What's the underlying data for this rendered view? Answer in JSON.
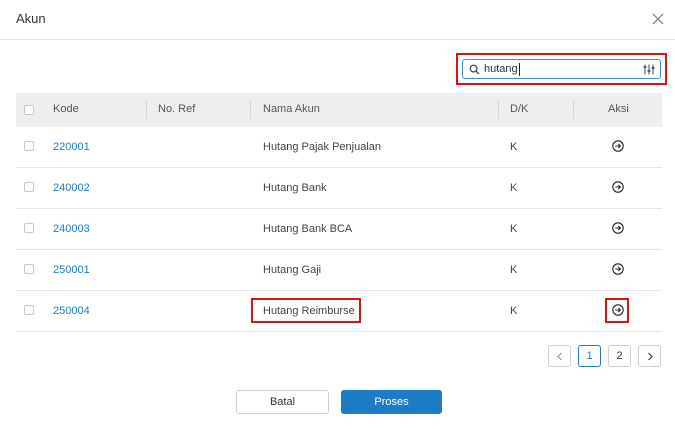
{
  "modal": {
    "title": "Akun"
  },
  "search": {
    "value": "hutang"
  },
  "table": {
    "columns": {
      "code": "Kode",
      "ref": "No. Ref",
      "name": "Nama Akun",
      "dk": "D/K",
      "action": "Aksi"
    },
    "rows": [
      {
        "code": "220001",
        "ref": "",
        "name": "Hutang Pajak Penjualan",
        "dk": "K"
      },
      {
        "code": "240002",
        "ref": "",
        "name": "Hutang Bank",
        "dk": "K"
      },
      {
        "code": "240003",
        "ref": "",
        "name": "Hutang Bank BCA",
        "dk": "K"
      },
      {
        "code": "250001",
        "ref": "",
        "name": "Hutang Gaji",
        "dk": "K"
      },
      {
        "code": "250004",
        "ref": "",
        "name": "Hutang Reimburse",
        "dk": "K"
      }
    ]
  },
  "pagination": {
    "pages": [
      "1",
      "2"
    ],
    "current": "1"
  },
  "footer": {
    "cancel_label": "Batal",
    "process_label": "Proses"
  },
  "colors": {
    "accent": "#1e7bc8",
    "highlight": "#dd1111"
  }
}
